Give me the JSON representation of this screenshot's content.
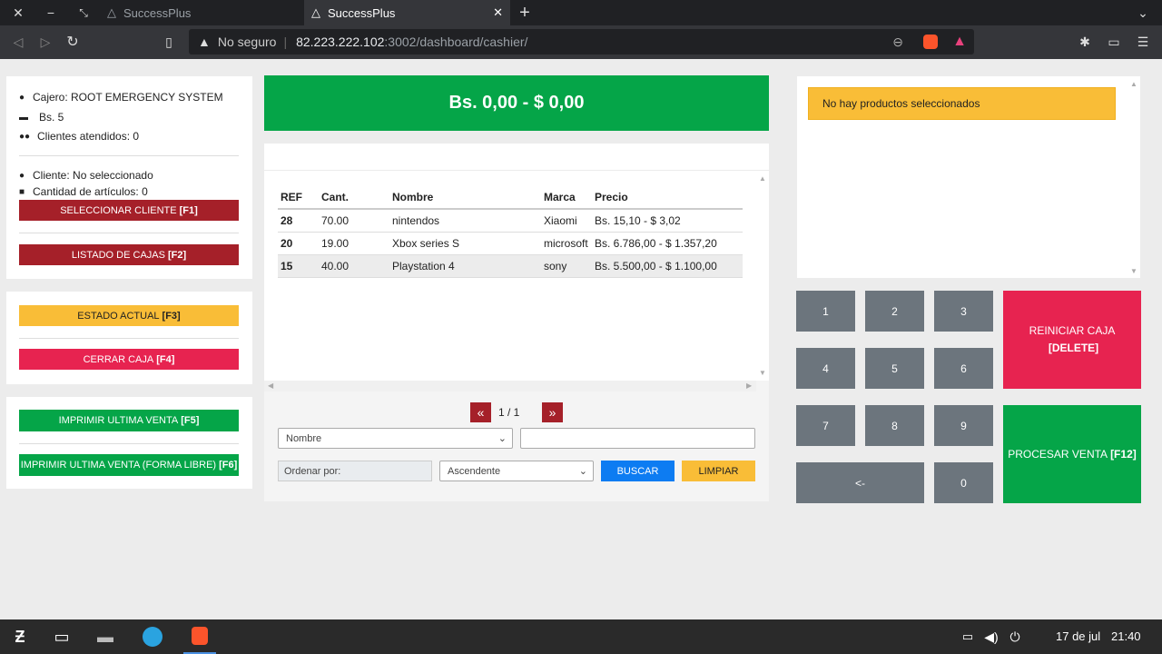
{
  "browser": {
    "tabs": [
      {
        "title": "SuccessPlus"
      },
      {
        "title": "SuccessPlus"
      }
    ],
    "security_label": "No seguro",
    "url_host": "82.223.222.102",
    "url_rest": ":3002/dashboard/cashier/"
  },
  "cashier": {
    "cajero": "Cajero: ROOT EMERGENCY SYSTEM",
    "saldo": "Bs. 5",
    "clientes": "Clientes atendidos: 0",
    "cliente": "Cliente: No seleccionado",
    "cantidad": "Cantidad de artículos: 0"
  },
  "buttons": {
    "seleccionar_cliente": "SELECCIONAR CLIENTE",
    "seleccionar_cliente_key": "[F1]",
    "listado_cajas": "LISTADO DE CAJAS",
    "listado_cajas_key": "[F2]",
    "estado_actual": "ESTADO ACTUAL",
    "estado_actual_key": "[F3]",
    "cerrar_caja": "CERRAR CAJA",
    "cerrar_caja_key": "[F4]",
    "imprimir_ultima": "IMPRIMIR ULTIMA VENTA",
    "imprimir_ultima_key": "[F5]",
    "imprimir_libre": "IMPRIMIR ULTIMA VENTA (FORMA LIBRE)",
    "imprimir_libre_key": "[F6]",
    "reiniciar": "REINICIAR CAJA",
    "reiniciar_key": "[DELETE]",
    "procesar": "PROCESAR VENTA",
    "procesar_key": "[F12]",
    "buscar": "BUSCAR",
    "limpiar": "LIMPIAR"
  },
  "total": "Bs. 0,00 - $ 0,00",
  "table": {
    "headers": [
      "REF",
      "Cant.",
      "Nombre",
      "Marca",
      "Precio"
    ],
    "rows": [
      [
        "28",
        "70.00",
        "nintendos",
        "Xiaomi",
        "Bs. 15,10 - $ 3,02"
      ],
      [
        "20",
        "19.00",
        "Xbox series S",
        "microsoft",
        "Bs. 6.786,00 - $ 1.357,20"
      ],
      [
        "15",
        "40.00",
        "Playstation 4",
        "sony",
        "Bs. 5.500,00 - $ 1.100,00"
      ]
    ]
  },
  "pagination": {
    "prev": "«",
    "label": "1 / 1",
    "next": "»"
  },
  "search": {
    "field_select": "Nombre",
    "order_label": "Ordenar por:",
    "order_select": "Ascendente"
  },
  "cart_empty": "No hay productos seleccionados",
  "keypad": [
    "1",
    "2",
    "3",
    "4",
    "5",
    "6",
    "7",
    "8",
    "9",
    "<-",
    "0"
  ],
  "taskbar": {
    "date": "17 de jul",
    "time": "21:40"
  },
  "colors": {
    "green": "#05a548",
    "red": "#a52029",
    "yellow": "#f9bd37",
    "pink": "#e72350",
    "blue": "#0d7cf2"
  }
}
